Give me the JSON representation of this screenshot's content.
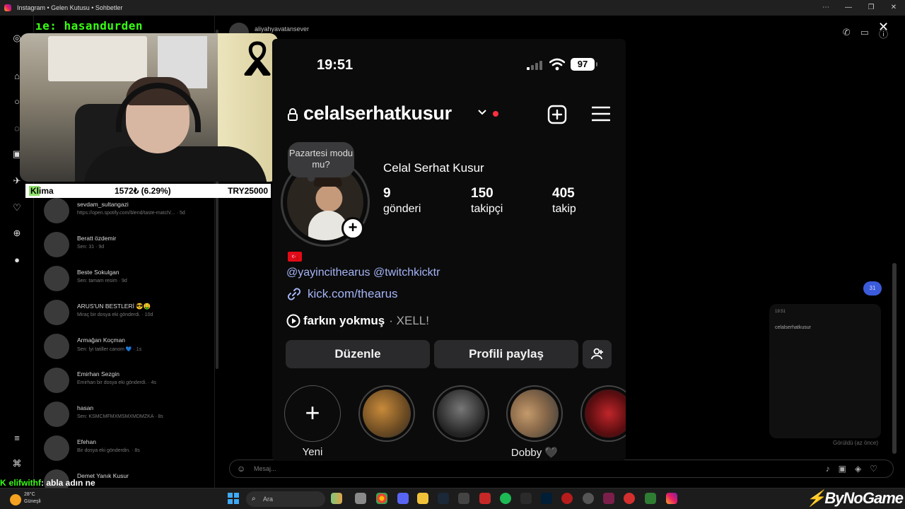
{
  "window": {
    "title": "Instagram • Gelen Kutusu • Sohbetler"
  },
  "stream": {
    "cam_label": "ıe: hasandurden",
    "ticker": {
      "name": "Klima",
      "change": "1572₺ (6.29%)",
      "value": "TRY25000"
    },
    "chat": {
      "user": "elifwithf",
      "message": ": abla adın ne"
    }
  },
  "background_app": {
    "chat_header_name": "aliyahyavatansever",
    "dm_items": [
      {
        "name": "sevdam_sultangazi",
        "sub": "https://open.spotify.com/blend/taste-match/... · 5d"
      },
      {
        "name": "Beratt özdemir",
        "sub": "Sen: 31 · 9d"
      },
      {
        "name": "Beste Sokulgan",
        "sub": "Sen: tamam resim · 9d"
      },
      {
        "name": "ARUS'UN BESTLERİ 😎🤑",
        "sub": "Miraç bir dosya eki gönderdi. · 10d"
      },
      {
        "name": "Armağan Koçman",
        "sub": "Sen: İyi tatiller canom 💙 · 1s"
      },
      {
        "name": "Emirhan Sezgin",
        "sub": "Emirhan bir dosya eki gönderdi. · 4s"
      },
      {
        "name": "hasan",
        "sub": "Sen: KSMCMFMXMSMXMDMZKA · 8s"
      },
      {
        "name": "Efehan",
        "sub": "Bir dosya eki gönderdin. · 8s"
      },
      {
        "name": "Demet Yanık Kusur",
        "sub": ""
      }
    ],
    "message_placeholder": "Mesaj...",
    "unread_badge": "31",
    "seen_text": "Görüldü (az önce)",
    "mini_time": "19:51",
    "mini_username": "celalserhatkusur"
  },
  "profile": {
    "status_time": "19:51",
    "battery": "97",
    "username": "celalserhatkusur",
    "note": "Pazartesi modu mu?",
    "full_name": "Celal Serhat Kusur",
    "stats": [
      {
        "number": "9",
        "label": "gönderi"
      },
      {
        "number": "150",
        "label": "takipçi"
      },
      {
        "number": "405",
        "label": "takip"
      }
    ],
    "flag_emoji": "🇹🇷",
    "mentions": "@yayincithearus @twitchkicktr",
    "link": "kick.com/thearus",
    "music_title": "farkın yokmuş",
    "music_artist": "· XELL!",
    "edit_button": "Düzenle",
    "share_button": "Profili paylaş",
    "highlights": [
      {
        "label": "Yeni"
      },
      {
        "label": ""
      },
      {
        "label": ""
      },
      {
        "label": "Dobby 🖤"
      },
      {
        "label": ""
      }
    ]
  },
  "taskbar": {
    "weather_temp": "28°C",
    "weather_desc": "Güneşli",
    "search_placeholder": "Ara",
    "watermark": "ByNoGame"
  },
  "colors": {
    "link": "#a4b4f6",
    "notify_dot": "#ff3040",
    "chat_green": "#39ff14"
  }
}
